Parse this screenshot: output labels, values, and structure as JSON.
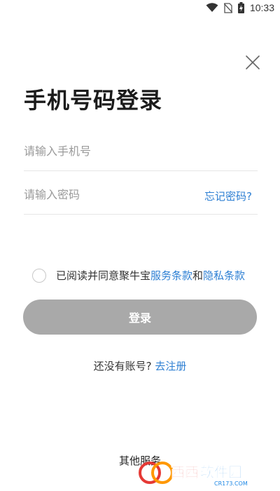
{
  "status_bar": {
    "time": "10:33",
    "icons": [
      "wifi-icon",
      "no-sim-icon",
      "battery-charging-icon"
    ]
  },
  "close_icon": "close-icon",
  "title": "手机号码登录",
  "phone_field": {
    "placeholder": "请输入手机号",
    "value": ""
  },
  "password_field": {
    "placeholder": "请输入密码",
    "value": ""
  },
  "forgot_password": "忘记密码?",
  "agreement": {
    "checked": false,
    "prefix": "已阅读并同意聚牛宝",
    "service_terms": "服务条款",
    "and": "和",
    "privacy_terms": "隐私条款"
  },
  "login_button": "登录",
  "register": {
    "prompt": "还没有账号?",
    "link": "去注册"
  },
  "other_services": "其他服务",
  "watermark": {
    "brand": "西西软件园",
    "url": "CR173.COM"
  },
  "colors": {
    "accent": "#2d7fd3",
    "button_disabled": "#a9a9a9"
  }
}
